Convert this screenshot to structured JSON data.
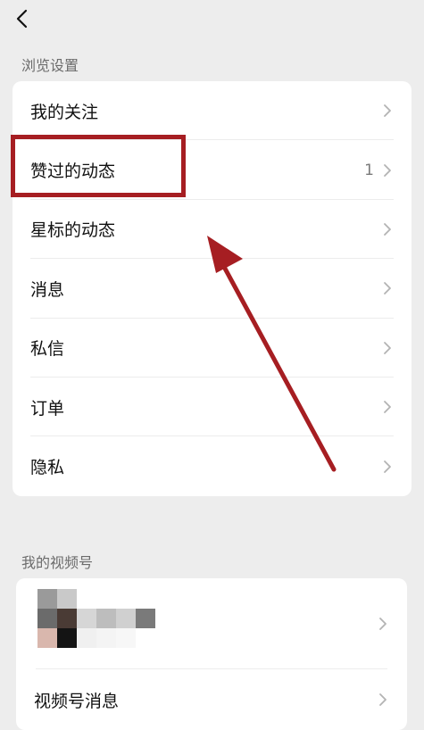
{
  "header": {
    "back_icon": "chevron-left-icon"
  },
  "browse_settings": {
    "title": "浏览设置",
    "items": [
      {
        "label": "我的关注",
        "count": ""
      },
      {
        "label": "赞过的动态",
        "count": "1"
      },
      {
        "label": "星标的动态",
        "count": ""
      },
      {
        "label": "消息",
        "count": ""
      },
      {
        "label": "私信",
        "count": ""
      },
      {
        "label": "订单",
        "count": ""
      },
      {
        "label": "隐私",
        "count": ""
      }
    ]
  },
  "channels": {
    "title": "我的视频号",
    "messages_label": "视频号消息"
  },
  "colors": {
    "annotation": "#a61e22",
    "background": "#ededed",
    "card": "#ffffff"
  }
}
